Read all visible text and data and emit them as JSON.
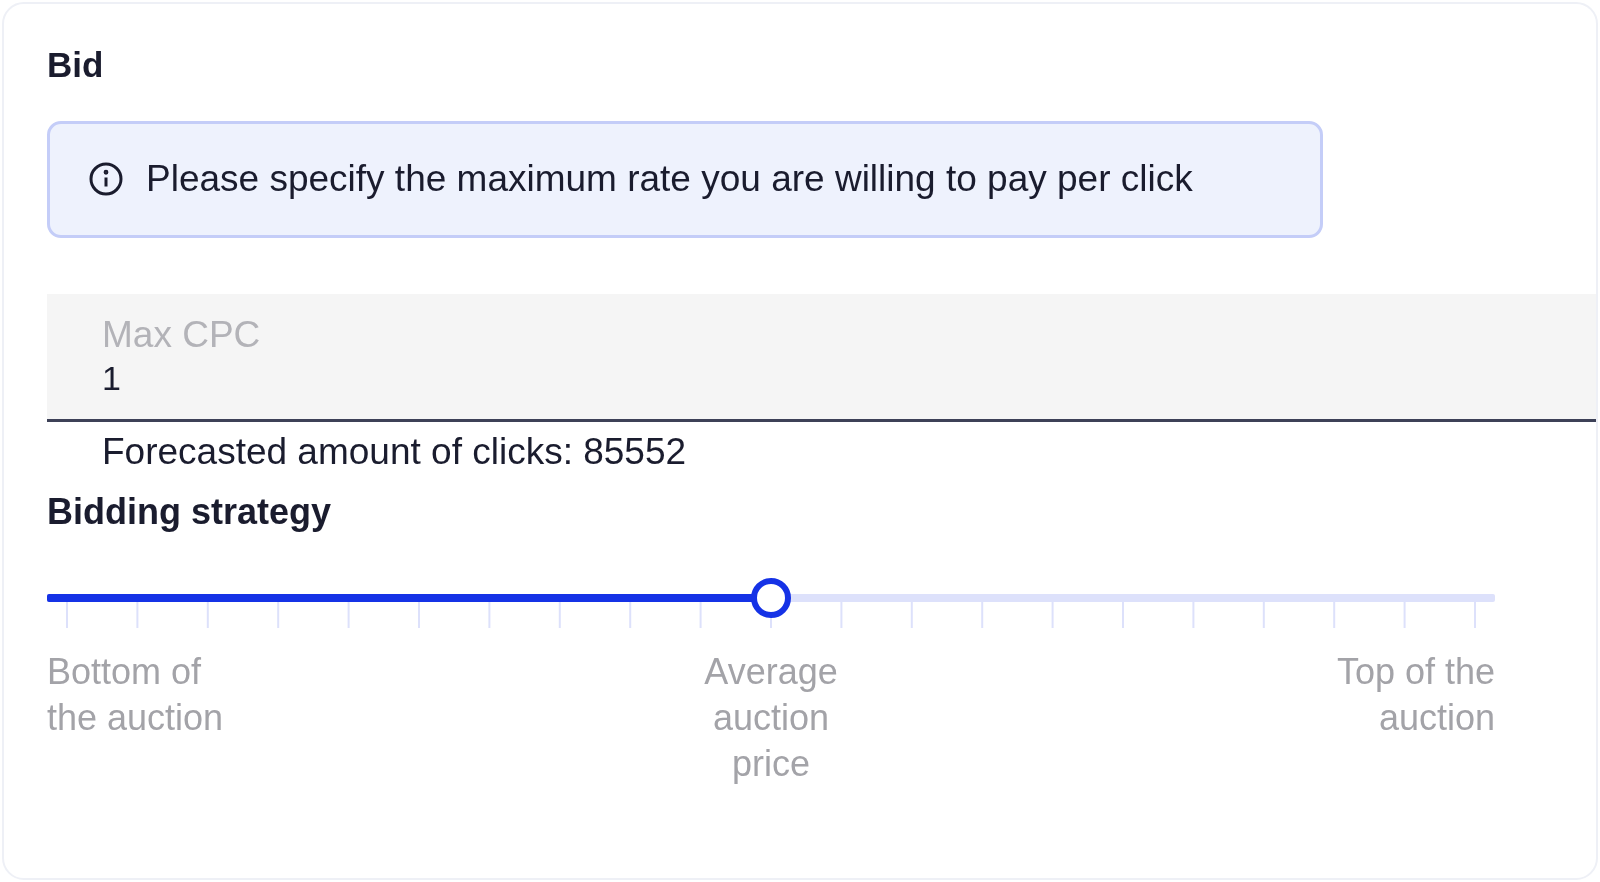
{
  "section": {
    "title": "Bid"
  },
  "info": {
    "text": "Please specify the maximum rate you are willing to pay per click"
  },
  "field": {
    "label": "Max CPC",
    "value": "1",
    "helper": "Forecasted amount of clicks: 85552"
  },
  "strategy": {
    "title": "Bidding strategy",
    "slider": {
      "level": 0.5,
      "labels": [
        "Bottom of the auction",
        "Average auction price",
        "Top of the auction"
      ]
    }
  }
}
